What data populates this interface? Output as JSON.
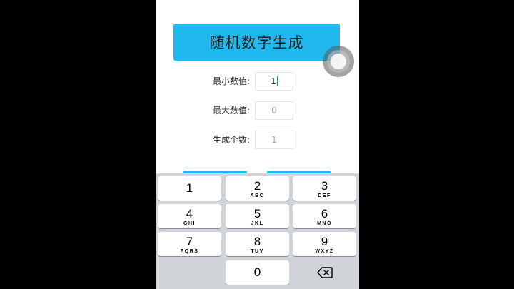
{
  "app": {
    "title": "随机数字生成"
  },
  "form": {
    "min_label": "最小数值:",
    "min_value": "1",
    "max_label": "最大数值:",
    "max_placeholder": "0",
    "count_label": "生成个数:",
    "count_placeholder": "1"
  },
  "keypad": {
    "keys": [
      {
        "num": "1",
        "letters": ""
      },
      {
        "num": "2",
        "letters": "ABC"
      },
      {
        "num": "3",
        "letters": "DEF"
      },
      {
        "num": "4",
        "letters": "GHI"
      },
      {
        "num": "5",
        "letters": "JKL"
      },
      {
        "num": "6",
        "letters": "MNO"
      },
      {
        "num": "7",
        "letters": "PQRS"
      },
      {
        "num": "8",
        "letters": "TUV"
      },
      {
        "num": "9",
        "letters": "WXYZ"
      },
      {
        "num": "0",
        "letters": ""
      }
    ],
    "delete_icon": "backspace-icon"
  },
  "colors": {
    "accent": "#1fb9f0",
    "keyboard_bg": "#d1d4d9",
    "caret": "#1aa34a"
  }
}
